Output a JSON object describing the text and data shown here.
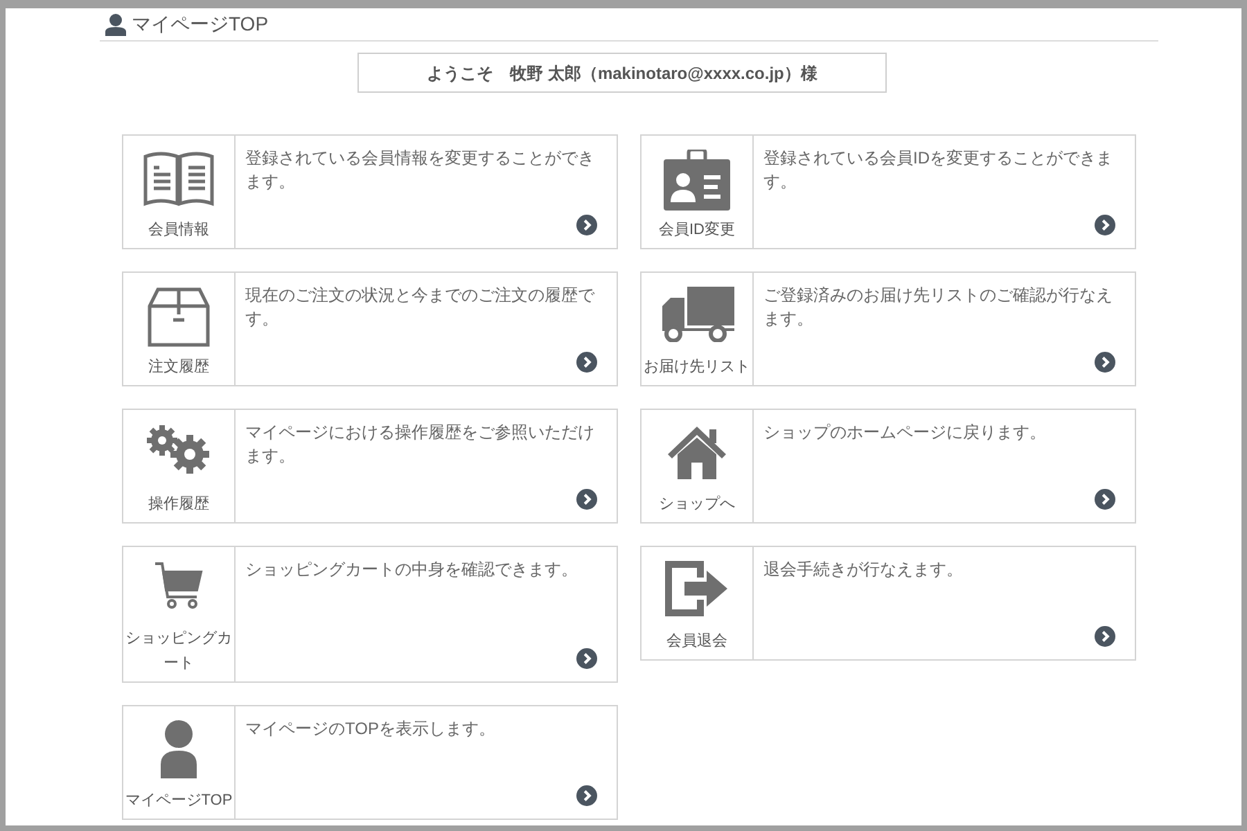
{
  "header": {
    "title": "マイページTOP"
  },
  "welcome": "ようこそ　牧野 太郎（makinotaro@xxxx.co.jp）様",
  "cards": [
    {
      "kind": "book",
      "label": "会員情報",
      "description": "登録されている会員情報を変更することができます。"
    },
    {
      "kind": "id-card",
      "label": "会員ID変更",
      "description": "登録されている会員IDを変更することができます。"
    },
    {
      "kind": "box",
      "label": "注文履歴",
      "description": "現在のご注文の状況と今までのご注文の履歴です。"
    },
    {
      "kind": "truck",
      "label": "お届け先リスト",
      "description": "ご登録済みのお届け先リストのご確認が行なえます。"
    },
    {
      "kind": "gears",
      "label": "操作履歴",
      "description": "マイページにおける操作履歴をご参照いただけます。"
    },
    {
      "kind": "house",
      "label": "ショップへ",
      "description": "ショップのホームページに戻ります。"
    },
    {
      "kind": "cart",
      "label": "ショッピングカート",
      "description": "ショッピングカートの中身を確認できます。"
    },
    {
      "kind": "exit",
      "label": "会員退会",
      "description": "退会手続きが行なえます。"
    },
    {
      "kind": "person",
      "label": "マイページTOP",
      "description": "マイページのTOPを表示します。"
    }
  ]
}
